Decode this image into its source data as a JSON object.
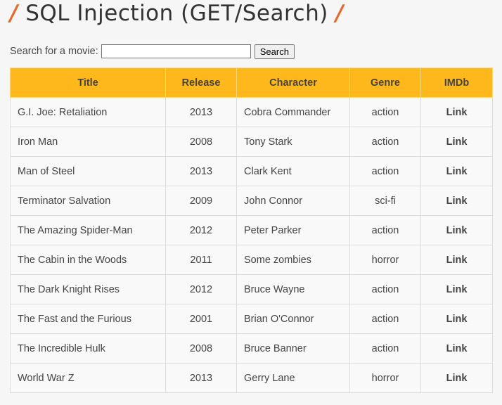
{
  "page": {
    "title_slash_left": "/",
    "title": "SQL Injection (GET/Search)",
    "title_slash_right": "/"
  },
  "search": {
    "label": "Search for a movie:",
    "value": "",
    "placeholder": "",
    "button_label": "Search"
  },
  "table": {
    "headers": [
      "Title",
      "Release",
      "Character",
      "Genre",
      "IMDb"
    ],
    "rows": [
      {
        "title": "G.I. Joe: Retaliation",
        "release": "2013",
        "character": "Cobra Commander",
        "genre": "action",
        "imdb": "Link"
      },
      {
        "title": "Iron Man",
        "release": "2008",
        "character": "Tony Stark",
        "genre": "action",
        "imdb": "Link"
      },
      {
        "title": "Man of Steel",
        "release": "2013",
        "character": "Clark Kent",
        "genre": "action",
        "imdb": "Link"
      },
      {
        "title": "Terminator Salvation",
        "release": "2009",
        "character": "John Connor",
        "genre": "sci-fi",
        "imdb": "Link"
      },
      {
        "title": "The Amazing Spider-Man",
        "release": "2012",
        "character": "Peter Parker",
        "genre": "action",
        "imdb": "Link"
      },
      {
        "title": "The Cabin in the Woods",
        "release": "2011",
        "character": "Some zombies",
        "genre": "horror",
        "imdb": "Link"
      },
      {
        "title": "The Dark Knight Rises",
        "release": "2012",
        "character": "Bruce Wayne",
        "genre": "action",
        "imdb": "Link"
      },
      {
        "title": "The Fast and the Furious",
        "release": "2001",
        "character": "Brian O'Connor",
        "genre": "action",
        "imdb": "Link"
      },
      {
        "title": "The Incredible Hulk",
        "release": "2008",
        "character": "Bruce Banner",
        "genre": "action",
        "imdb": "Link"
      },
      {
        "title": "World War Z",
        "release": "2013",
        "character": "Gerry Lane",
        "genre": "horror",
        "imdb": "Link"
      }
    ]
  },
  "colors": {
    "header_bg": "#ffb81c",
    "accent_slash": "#e8692a",
    "page_bg": "#f6f6f6"
  }
}
